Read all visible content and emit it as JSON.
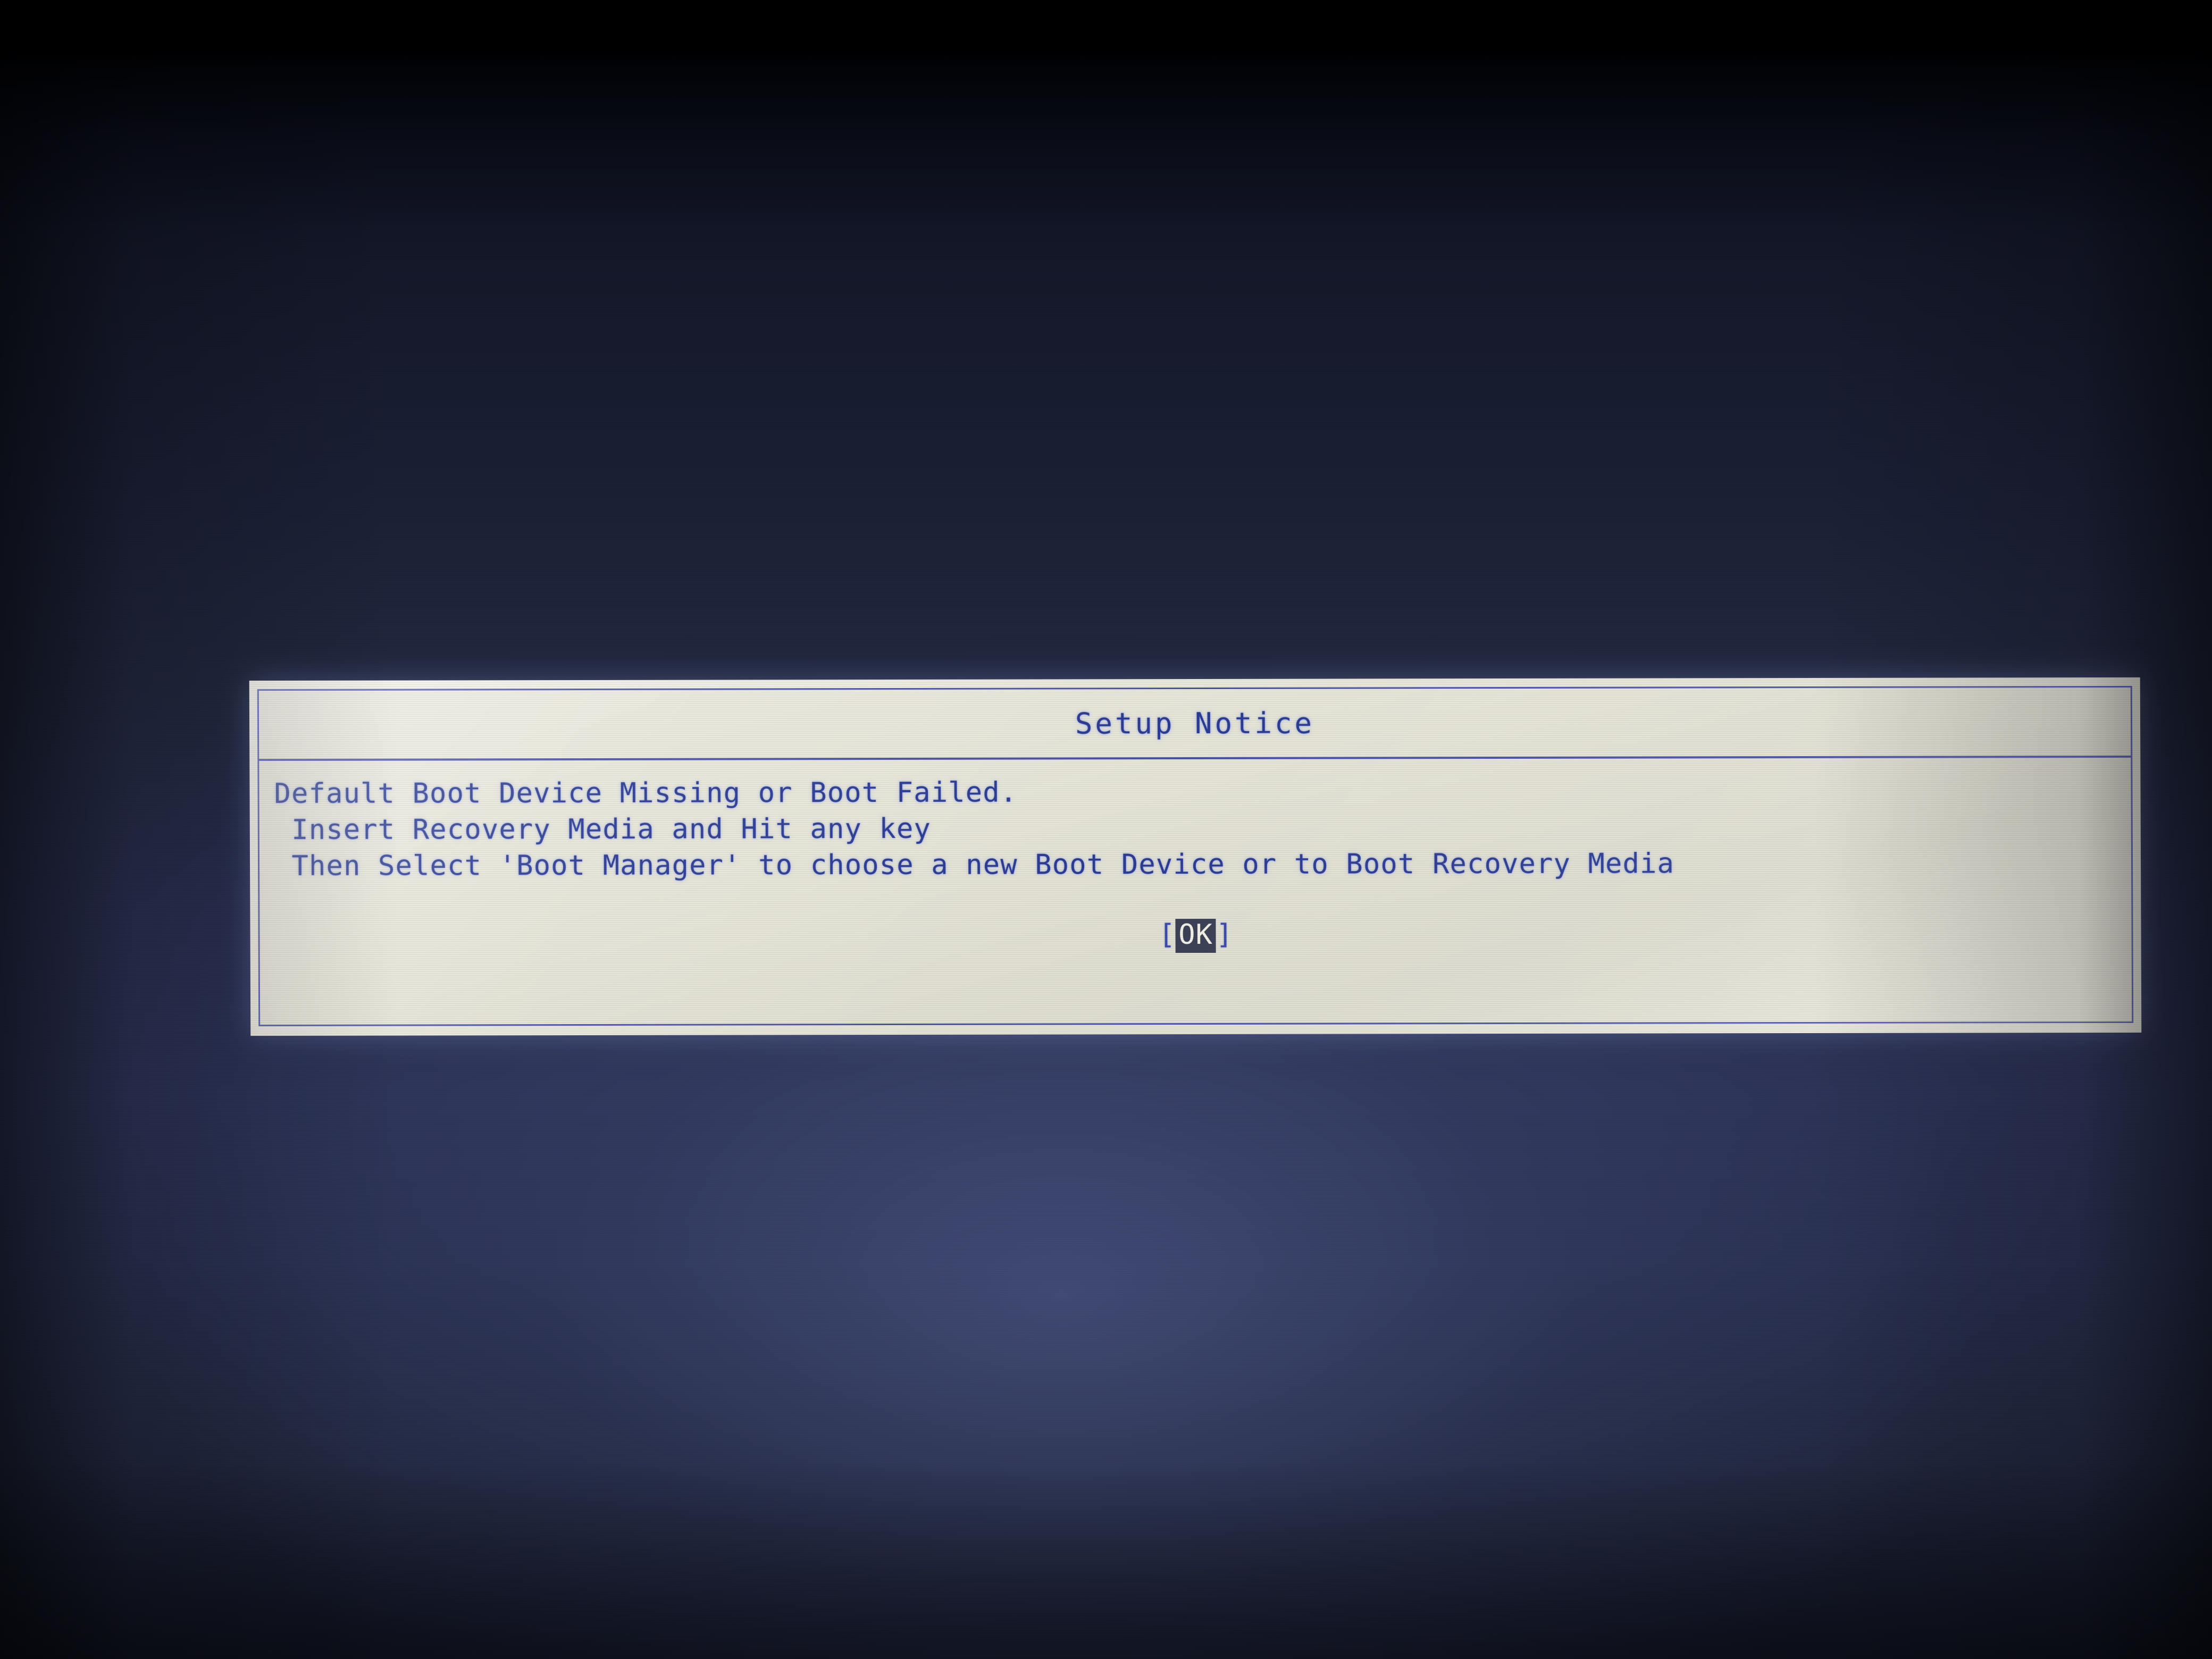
{
  "screen": {
    "background_top_color": "#000000",
    "background_bottom_color": "#2a3052",
    "glow_color": "#5662a0"
  },
  "dialog": {
    "title": "Setup Notice",
    "frame_color": "#e8e7dc",
    "border_color": "#4a52a8",
    "text_color": "#2b3b93",
    "message_lines": [
      "Default Boot Device Missing or Boot Failed.",
      " Insert Recovery Media and Hit any key",
      " Then Select 'Boot Manager' to choose a new Boot Device or to Boot Recovery Media"
    ],
    "button": {
      "open_bracket": "[",
      "label": "OK",
      "close_bracket": "]",
      "selected": true,
      "highlight_bg": "#3a3f55",
      "highlight_fg": "#f2f1e6"
    }
  }
}
